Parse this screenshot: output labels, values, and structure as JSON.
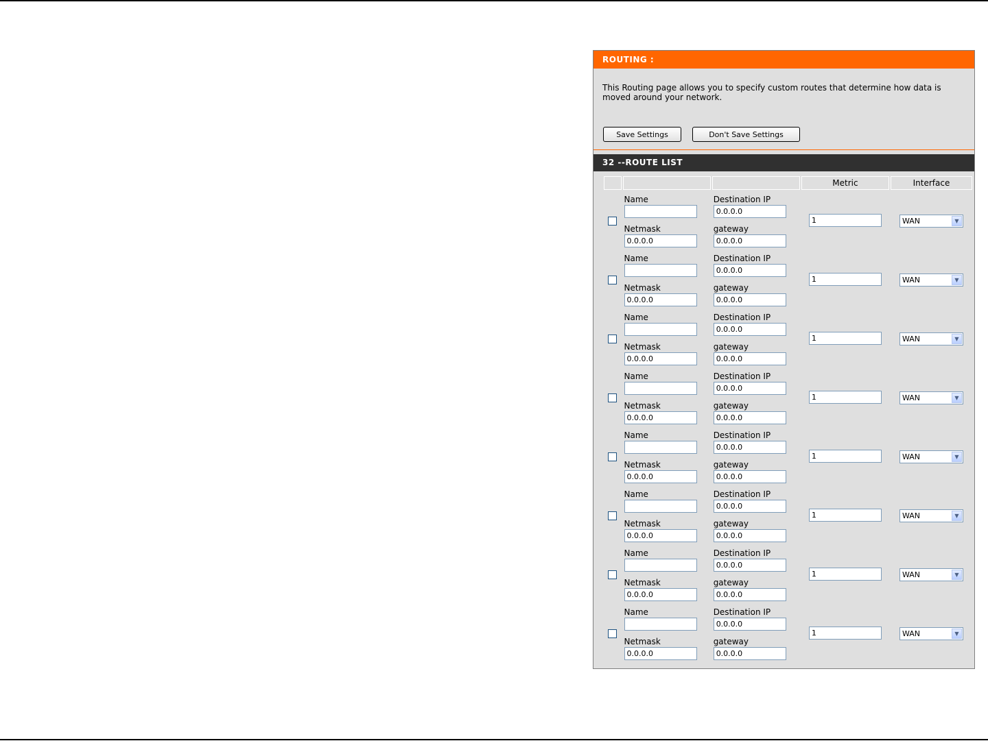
{
  "routing": {
    "title": "ROUTING :",
    "description": "This Routing page allows you to specify custom routes that determine how data is moved around your network.",
    "save_label": "Save Settings",
    "dont_save_label": "Don't Save Settings"
  },
  "route_list": {
    "title": "32 --ROUTE LIST",
    "headers": {
      "metric": "Metric",
      "interface": "Interface"
    },
    "labels": {
      "name": "Name",
      "dest": "Destination IP",
      "netmask": "Netmask",
      "gateway": "gateway"
    },
    "rows": [
      {
        "name": "",
        "dest": "0.0.0.0",
        "netmask": "0.0.0.0",
        "gateway": "0.0.0.0",
        "metric": "1",
        "interface": "WAN"
      },
      {
        "name": "",
        "dest": "0.0.0.0",
        "netmask": "0.0.0.0",
        "gateway": "0.0.0.0",
        "metric": "1",
        "interface": "WAN"
      },
      {
        "name": "",
        "dest": "0.0.0.0",
        "netmask": "0.0.0.0",
        "gateway": "0.0.0.0",
        "metric": "1",
        "interface": "WAN"
      },
      {
        "name": "",
        "dest": "0.0.0.0",
        "netmask": "0.0.0.0",
        "gateway": "0.0.0.0",
        "metric": "1",
        "interface": "WAN"
      },
      {
        "name": "",
        "dest": "0.0.0.0",
        "netmask": "0.0.0.0",
        "gateway": "0.0.0.0",
        "metric": "1",
        "interface": "WAN"
      },
      {
        "name": "",
        "dest": "0.0.0.0",
        "netmask": "0.0.0.0",
        "gateway": "0.0.0.0",
        "metric": "1",
        "interface": "WAN"
      },
      {
        "name": "",
        "dest": "0.0.0.0",
        "netmask": "0.0.0.0",
        "gateway": "0.0.0.0",
        "metric": "1",
        "interface": "WAN"
      },
      {
        "name": "",
        "dest": "0.0.0.0",
        "netmask": "0.0.0.0",
        "gateway": "0.0.0.0",
        "metric": "1",
        "interface": "WAN"
      }
    ]
  },
  "icons": {
    "dropdown": "chevron-down-icon",
    "checkbox": "checkbox-unchecked"
  }
}
